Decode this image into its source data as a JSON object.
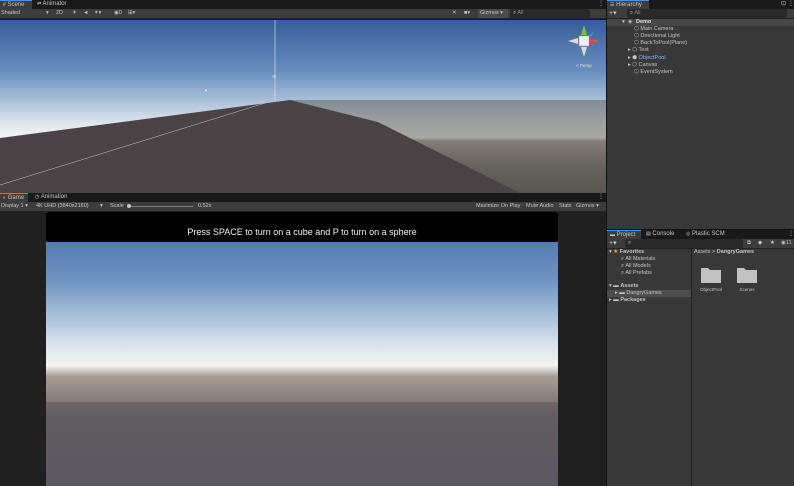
{
  "scene_tabs": {
    "scene": "Scene",
    "animator": "Animator"
  },
  "scene_toolbar": {
    "shading": "Shaded",
    "mode_2d": "2D",
    "gizmos": "Gizmos",
    "search_placeholder": "All"
  },
  "scene_gizmo": {
    "persp_label": "< Persp"
  },
  "game_tabs": {
    "game": "Game",
    "animation": "Animation"
  },
  "game_toolbar": {
    "display": "Display 1",
    "resolution": "4K UHD (3840x2160)",
    "scale_label": "Scale",
    "scale_value": "0.52x",
    "maximize": "Maximize On Play",
    "mute": "Mute Audio",
    "stats": "Stats",
    "gizmos": "Gizmos"
  },
  "game_banner": "Press SPACE to turn on a cube and P to turn on a sphere",
  "hierarchy": {
    "tab": "Hierarchy",
    "search_placeholder": "All",
    "scene_name": "Demo",
    "items": [
      {
        "label": "Main Camera"
      },
      {
        "label": "Directional Light"
      },
      {
        "label": "BackToPool(Plane)"
      },
      {
        "label": "Test"
      },
      {
        "label": "ObjectPool"
      },
      {
        "label": "Canvas"
      },
      {
        "label": "EventSystem"
      }
    ]
  },
  "project_tabs": {
    "project": "Project",
    "console": "Console",
    "plastic": "Plastic SCM"
  },
  "project": {
    "favorites": "Favorites",
    "fav_items": [
      "All Materials",
      "All Models",
      "All Prefabs"
    ],
    "assets": "Assets",
    "assets_child": "DangryGames",
    "packages": "Packages",
    "breadcrumb_root": "Assets",
    "breadcrumb_sep": ">",
    "breadcrumb_leaf": "DangryGames",
    "folders": [
      "ObjectPool",
      "Scenes"
    ],
    "badge_count": "11"
  },
  "colors": {
    "accent": "#5a8fd6",
    "selected_row": "#2c5d87",
    "prefab_blue": "#7fb4ff"
  }
}
